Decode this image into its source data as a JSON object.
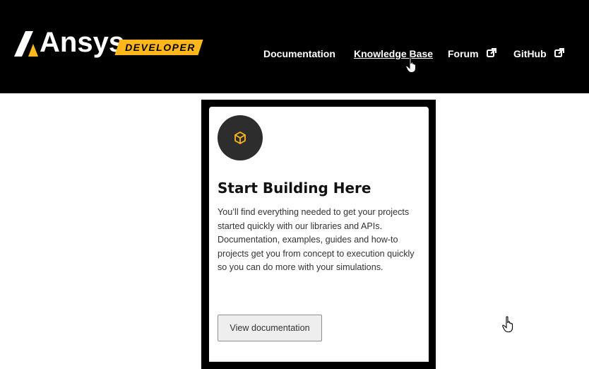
{
  "header": {
    "logo": {
      "brand": "Ansys",
      "badge": "DEVELOPER"
    },
    "nav": [
      {
        "label": "Documentation",
        "external": false
      },
      {
        "label": "Knowledge Base",
        "external": false
      },
      {
        "label": "Forum",
        "external": true
      },
      {
        "label": "GitHub",
        "external": true
      }
    ]
  },
  "card": {
    "icon": "cube-icon",
    "title": "Start Building Here",
    "description": "You’ll find everything needed to get your projects started quickly with our libraries and APIs. Documentation, examples, guides and how-to projects get you from concept to execution quickly so you can do more with your simulations.",
    "button_label": "View documentation"
  },
  "colors": {
    "header_bg": "#000000",
    "accent": "#ffb71b",
    "icon_circle": "#2d2d2d",
    "button_bg": "#eeeeee"
  }
}
